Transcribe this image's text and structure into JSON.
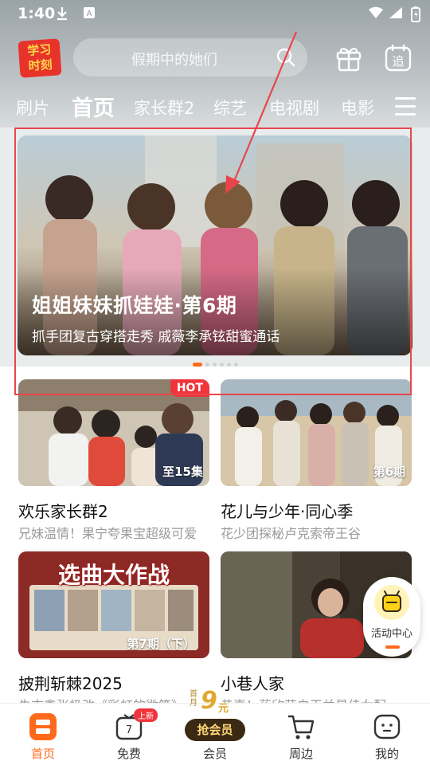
{
  "status_bar": {
    "time": "1:40",
    "icons": [
      "download-icon",
      "font-app-icon",
      "wifi-icon",
      "signal-icon",
      "battery-icon"
    ]
  },
  "header": {
    "logo_text_line1": "学习",
    "logo_text_line2": "时刻",
    "search_placeholder": "假期中的她们",
    "gift_icon": "gift-icon",
    "follow_icon_label": "追"
  },
  "channel_tabs": [
    {
      "label": "刷片",
      "active": false
    },
    {
      "label": "首页",
      "active": true
    },
    {
      "label": "家长群2",
      "active": false
    },
    {
      "label": "综艺",
      "active": false
    },
    {
      "label": "电视剧",
      "active": false
    },
    {
      "label": "电影",
      "active": false
    }
  ],
  "banner": {
    "title": "姐姐妹妹抓娃娃·第6期",
    "subtitle": "抓手团复古穿搭走秀 戚薇李承铉甜蜜通话",
    "dot_count": 6,
    "active_dot": 0
  },
  "cards": [
    {
      "title": "欢乐家长群2",
      "desc": "兄妹温情！果宁夸果宝超级可爱",
      "episode": "至15集",
      "badge": "HOT"
    },
    {
      "title": "花儿与少年·同心季",
      "desc": "花少团探秘卢克索帝王谷",
      "episode": "第6期",
      "badge": ""
    },
    {
      "title": "披荆斩棘2025",
      "desc": "朱志鑫张极改《彩虹的微笑》",
      "episode": "第7期（下）",
      "thumb_text": "选曲大作战",
      "badge": ""
    },
    {
      "title": "小巷人家",
      "desc": "恭喜！蒋欣获白玉兰最佳女配",
      "episode": "",
      "badge": ""
    }
  ],
  "floating": {
    "label": "活动中心"
  },
  "bottom_nav": {
    "items": [
      {
        "label": "首页",
        "icon": "home-icon",
        "active": true
      },
      {
        "label": "免费",
        "icon": "tv-free-icon",
        "active": false,
        "badge": "上新"
      },
      {
        "label": "会员",
        "icon": "vip-icon",
        "active": false
      },
      {
        "label": "周边",
        "icon": "cart-icon",
        "active": false
      },
      {
        "label": "我的",
        "icon": "profile-icon",
        "active": false
      }
    ],
    "vip_first_label": "首月",
    "vip_price": "9",
    "vip_price_unit": "元",
    "vip_button": "抢会员"
  },
  "colors": {
    "accent": "#ff6a1a",
    "hot": "#f0343c",
    "highlight_frame": "#e8454b"
  }
}
